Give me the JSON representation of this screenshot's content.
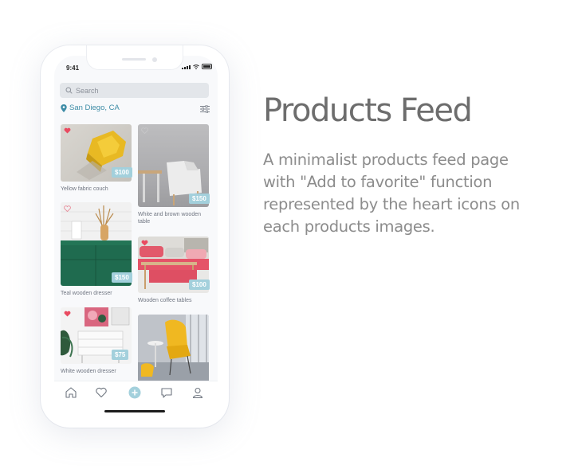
{
  "status_bar": {
    "time": "9:41"
  },
  "search": {
    "placeholder": "Search"
  },
  "location": {
    "label": "San Diego, CA"
  },
  "products": [
    {
      "caption": "Yellow fabric couch",
      "price": "$100",
      "favorited": true
    },
    {
      "caption": "White and brown wooden table",
      "price": "$150",
      "favorited": false
    },
    {
      "caption": "Teal wooden dresser",
      "price": "$150",
      "favorited": false
    },
    {
      "caption": "Wooden coffee tables",
      "price": "$100",
      "favorited": true
    },
    {
      "caption": "White wooden dresser",
      "price": "$75",
      "favorited": true
    },
    {
      "caption": "",
      "price": "",
      "favorited": false
    }
  ],
  "tabbar": [
    "home-icon",
    "heart-icon",
    "add-icon",
    "chat-icon",
    "profile-icon"
  ],
  "colors": {
    "accent": "#3d8ca6",
    "heart": "#e94a60",
    "price_badge": "#a3d0dc",
    "add_button": "#a3d0dc"
  },
  "heading": {
    "title": "Products Feed",
    "description": "A minimalist products feed page with \"Add to favorite\" function represented by the heart icons on each products images."
  }
}
